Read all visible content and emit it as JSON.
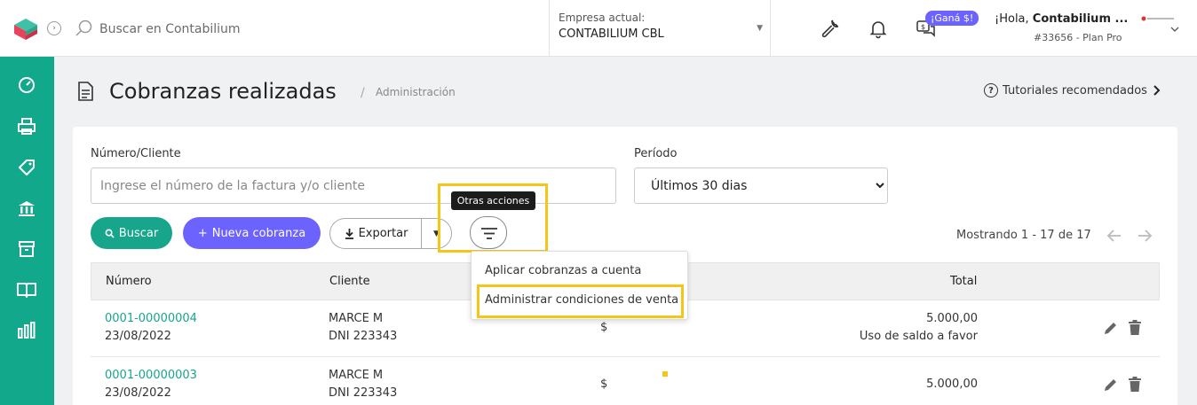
{
  "topbar": {
    "search_placeholder": "Buscar en Contabilium",
    "company_label": "Empresa actual:",
    "company_name": "CONTABILIUM CBL",
    "promo_badge": "¡Ganá $!",
    "greeting_prefix": "¡Hola, ",
    "greeting_name": "Contabilium ...",
    "account_info": "#33656 - Plan Pro"
  },
  "sidebar": {
    "items": [
      "dashboard-icon",
      "printer-icon",
      "tag-icon",
      "bank-icon",
      "box-icon",
      "book-icon",
      "bar-chart-icon"
    ],
    "color": "#11a88c"
  },
  "page": {
    "title": "Cobranzas realizadas",
    "breadcrumb_sep": "/",
    "breadcrumb": "Administración",
    "tutorials": "Tutoriales recomendados"
  },
  "filters": {
    "client_label": "Número/Cliente",
    "client_placeholder": "Ingrese el número de la factura y/o cliente",
    "period_label": "Período",
    "period_value": "Últimos 30 dias"
  },
  "actions": {
    "search": "Buscar",
    "new_collection": "Nueva cobranza",
    "export": "Exportar",
    "tooltip": "Otras acciones",
    "showing": "Mostrando 1 - 17 de 17"
  },
  "dropdown": {
    "items": [
      "Aplicar cobranzas a cuenta",
      "Administrar condiciones de venta"
    ]
  },
  "table": {
    "headers": [
      "Número",
      "Cliente",
      "Total"
    ],
    "rows": [
      {
        "number": "0001-00000004",
        "date": "23/08/2022",
        "client": "MARCE M",
        "dni": "DNI 223343",
        "currency": "$",
        "total": "5.000,00",
        "note": "Uso de saldo a favor"
      },
      {
        "number": "0001-00000003",
        "date": "23/08/2022",
        "client": "MARCE M",
        "dni": "DNI 223343",
        "currency": "$",
        "total": "5.000,00",
        "note": ""
      }
    ]
  },
  "colors": {
    "accent": "#17a58b",
    "primary": "#6c63ff",
    "highlight": "#f5c518"
  }
}
